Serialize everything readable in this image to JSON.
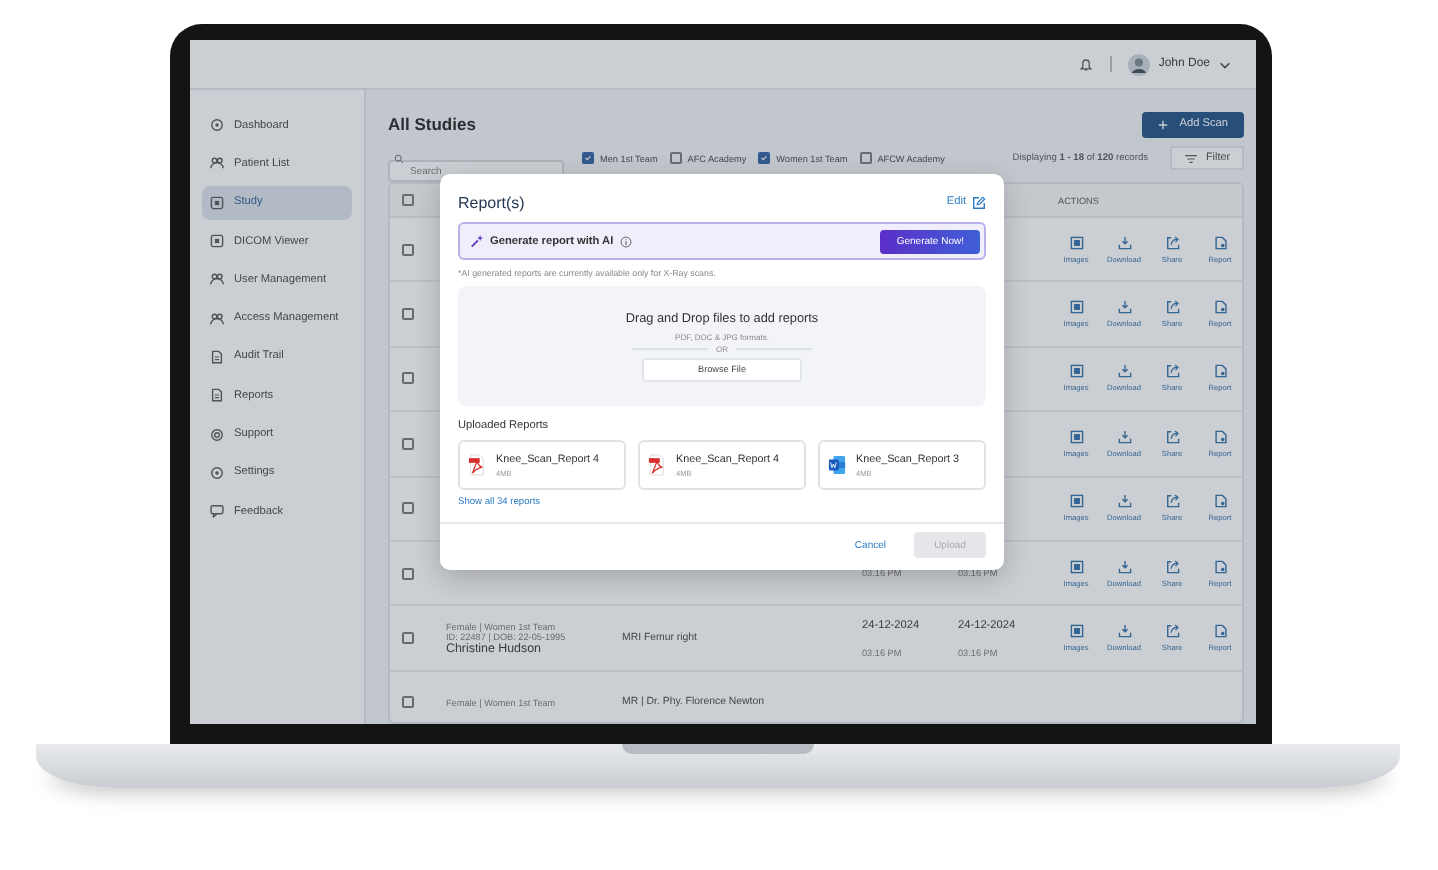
{
  "topbar": {
    "user_name": "John Doe"
  },
  "sidebar": {
    "items": [
      {
        "kind": "dashboard",
        "label": "Dashboard",
        "selected": false
      },
      {
        "kind": "patients",
        "label": "Patient List",
        "selected": false
      },
      {
        "kind": "study",
        "label": "Study",
        "selected": true
      },
      {
        "kind": "viewer",
        "label": "DICOM Viewer",
        "selected": false
      },
      {
        "kind": "users",
        "label": "User Management",
        "selected": false
      },
      {
        "kind": "access",
        "label": "Access Management",
        "selected": false
      },
      {
        "kind": "audit",
        "label": "Audit Trail",
        "selected": false
      },
      {
        "kind": "reports",
        "label": "Reports",
        "selected": false
      },
      {
        "kind": "support",
        "label": "Support",
        "selected": false
      },
      {
        "kind": "settings",
        "label": "Settings",
        "selected": false
      },
      {
        "kind": "feedback",
        "label": "Feedback",
        "selected": false
      }
    ]
  },
  "page": {
    "title": "All Studies",
    "add_button": "Add Scan",
    "search": {
      "placeholder": "Search"
    },
    "team_filters": [
      {
        "label": "Men 1st Team",
        "checked": true
      },
      {
        "label": "AFC Academy",
        "checked": false
      },
      {
        "label": "Women 1st Team",
        "checked": true
      },
      {
        "label": "AFCW Academy",
        "checked": false
      }
    ],
    "records": "Displaying **1 - 18** of **120** records",
    "filter_button": "Filter"
  },
  "table": {
    "header_checked": false,
    "actions_header": "ACTIONS",
    "rows": [
      {
        "checked": false,
        "actions": [
          {
            "kind": "images",
            "label": "Images"
          },
          {
            "kind": "download",
            "label": "Download"
          },
          {
            "kind": "share",
            "label": "Share"
          },
          {
            "kind": "report",
            "label": "Report"
          }
        ]
      },
      {
        "checked": false,
        "actions": [
          {
            "kind": "images",
            "label": "Images"
          },
          {
            "kind": "download",
            "label": "Download"
          },
          {
            "kind": "share",
            "label": "Share"
          },
          {
            "kind": "report",
            "label": "Report"
          }
        ]
      },
      {
        "checked": false,
        "actions": [
          {
            "kind": "images",
            "label": "Images"
          },
          {
            "kind": "download",
            "label": "Download"
          },
          {
            "kind": "share",
            "label": "Share"
          },
          {
            "kind": "report",
            "label": "Report"
          }
        ]
      },
      {
        "checked": false,
        "actions": [
          {
            "kind": "images",
            "label": "Images"
          },
          {
            "kind": "download",
            "label": "Download"
          },
          {
            "kind": "share",
            "label": "Share"
          },
          {
            "kind": "report",
            "label": "Report"
          }
        ]
      },
      {
        "checked": false,
        "actions": [
          {
            "kind": "images",
            "label": "Images"
          },
          {
            "kind": "download",
            "label": "Download"
          },
          {
            "kind": "share",
            "label": "Share"
          },
          {
            "kind": "report",
            "label": "Report"
          }
        ]
      },
      {
        "checked": false,
        "created": [
          "03:16 PM"
        ],
        "updated": [
          "03:16 PM"
        ],
        "actions": [
          {
            "kind": "images",
            "label": "Images"
          },
          {
            "kind": "download",
            "label": "Download"
          },
          {
            "kind": "share",
            "label": "Share"
          },
          {
            "kind": "report",
            "label": "Report"
          }
        ]
      },
      {
        "checked": false,
        "patient": [
          "Female | Women 1st Team",
          "ID: 22487 | DOB: 22-05-1995",
          "Christine Hudson"
        ],
        "study": [
          "MRI Femur right"
        ],
        "created": [
          "24-12-2024",
          "03:16 PM"
        ],
        "updated": [
          "24-12-2024",
          "03:16 PM"
        ],
        "actions": [
          {
            "kind": "images",
            "label": "Images"
          },
          {
            "kind": "download",
            "label": "Download"
          },
          {
            "kind": "share",
            "label": "Share"
          },
          {
            "kind": "report",
            "label": "Report"
          }
        ]
      },
      {
        "checked": false,
        "patient": [
          "Female | Women 1st Team"
        ],
        "study": [
          "MR | Dr. Phy. Florence Newton"
        ]
      }
    ]
  },
  "modal": {
    "title": "Report(s)",
    "edit_link": "Edit",
    "ai_banner": "Generate report with AI",
    "generate_button": "Generate Now!",
    "note": "*AI generated reports are currently available only for X-Ray scans.",
    "dropzone": {
      "title": "Drag and Drop files to add reports",
      "formats": "PDF, DOC & JPG formats.",
      "separator": "OR",
      "browse_button": "Browse File"
    },
    "uploaded_title": "Uploaded Reports",
    "files": [
      {
        "kind": "pdf",
        "name": "Knee_Scan_Report 4",
        "size": "4MB"
      },
      {
        "kind": "pdf",
        "name": "Knee_Scan_Report 4",
        "size": "4MB"
      },
      {
        "kind": "word",
        "name": "Knee_Scan_Report 3",
        "size": "4MB"
      }
    ],
    "show_all_link": "Show all 34 reports",
    "cancel_button": "Cancel",
    "upload_button": {
      "label": "Upload",
      "disabled": true
    }
  }
}
